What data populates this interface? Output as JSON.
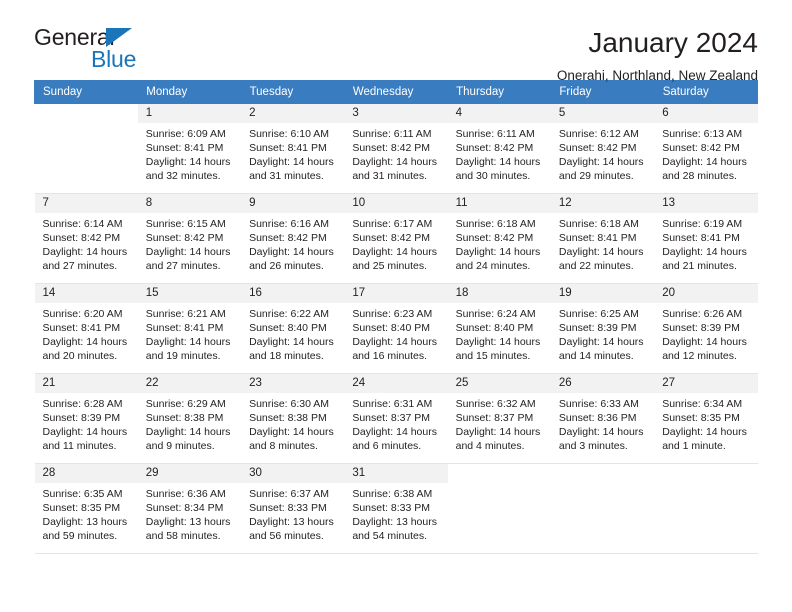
{
  "brand": {
    "name_part1": "General",
    "name_part2": "Blue",
    "accent_color": "#1b75bb",
    "triangle_icon": "logo-triangle-icon"
  },
  "header": {
    "title": "January 2024",
    "subtitle": "Onerahi, Northland, New Zealand"
  },
  "calendar": {
    "header_bg": "#3a7cc0",
    "daynum_bg": "#f2f2f2",
    "weekdays": [
      "Sunday",
      "Monday",
      "Tuesday",
      "Wednesday",
      "Thursday",
      "Friday",
      "Saturday"
    ],
    "weeks": [
      [
        {
          "day": "",
          "sunrise": "",
          "sunset": "",
          "daylight1": "",
          "daylight2": "",
          "empty": true
        },
        {
          "day": "1",
          "sunrise": "Sunrise: 6:09 AM",
          "sunset": "Sunset: 8:41 PM",
          "daylight1": "Daylight: 14 hours",
          "daylight2": "and 32 minutes."
        },
        {
          "day": "2",
          "sunrise": "Sunrise: 6:10 AM",
          "sunset": "Sunset: 8:41 PM",
          "daylight1": "Daylight: 14 hours",
          "daylight2": "and 31 minutes."
        },
        {
          "day": "3",
          "sunrise": "Sunrise: 6:11 AM",
          "sunset": "Sunset: 8:42 PM",
          "daylight1": "Daylight: 14 hours",
          "daylight2": "and 31 minutes."
        },
        {
          "day": "4",
          "sunrise": "Sunrise: 6:11 AM",
          "sunset": "Sunset: 8:42 PM",
          "daylight1": "Daylight: 14 hours",
          "daylight2": "and 30 minutes."
        },
        {
          "day": "5",
          "sunrise": "Sunrise: 6:12 AM",
          "sunset": "Sunset: 8:42 PM",
          "daylight1": "Daylight: 14 hours",
          "daylight2": "and 29 minutes."
        },
        {
          "day": "6",
          "sunrise": "Sunrise: 6:13 AM",
          "sunset": "Sunset: 8:42 PM",
          "daylight1": "Daylight: 14 hours",
          "daylight2": "and 28 minutes."
        }
      ],
      [
        {
          "day": "7",
          "sunrise": "Sunrise: 6:14 AM",
          "sunset": "Sunset: 8:42 PM",
          "daylight1": "Daylight: 14 hours",
          "daylight2": "and 27 minutes."
        },
        {
          "day": "8",
          "sunrise": "Sunrise: 6:15 AM",
          "sunset": "Sunset: 8:42 PM",
          "daylight1": "Daylight: 14 hours",
          "daylight2": "and 27 minutes."
        },
        {
          "day": "9",
          "sunrise": "Sunrise: 6:16 AM",
          "sunset": "Sunset: 8:42 PM",
          "daylight1": "Daylight: 14 hours",
          "daylight2": "and 26 minutes."
        },
        {
          "day": "10",
          "sunrise": "Sunrise: 6:17 AM",
          "sunset": "Sunset: 8:42 PM",
          "daylight1": "Daylight: 14 hours",
          "daylight2": "and 25 minutes."
        },
        {
          "day": "11",
          "sunrise": "Sunrise: 6:18 AM",
          "sunset": "Sunset: 8:42 PM",
          "daylight1": "Daylight: 14 hours",
          "daylight2": "and 24 minutes."
        },
        {
          "day": "12",
          "sunrise": "Sunrise: 6:18 AM",
          "sunset": "Sunset: 8:41 PM",
          "daylight1": "Daylight: 14 hours",
          "daylight2": "and 22 minutes."
        },
        {
          "day": "13",
          "sunrise": "Sunrise: 6:19 AM",
          "sunset": "Sunset: 8:41 PM",
          "daylight1": "Daylight: 14 hours",
          "daylight2": "and 21 minutes."
        }
      ],
      [
        {
          "day": "14",
          "sunrise": "Sunrise: 6:20 AM",
          "sunset": "Sunset: 8:41 PM",
          "daylight1": "Daylight: 14 hours",
          "daylight2": "and 20 minutes."
        },
        {
          "day": "15",
          "sunrise": "Sunrise: 6:21 AM",
          "sunset": "Sunset: 8:41 PM",
          "daylight1": "Daylight: 14 hours",
          "daylight2": "and 19 minutes."
        },
        {
          "day": "16",
          "sunrise": "Sunrise: 6:22 AM",
          "sunset": "Sunset: 8:40 PM",
          "daylight1": "Daylight: 14 hours",
          "daylight2": "and 18 minutes."
        },
        {
          "day": "17",
          "sunrise": "Sunrise: 6:23 AM",
          "sunset": "Sunset: 8:40 PM",
          "daylight1": "Daylight: 14 hours",
          "daylight2": "and 16 minutes."
        },
        {
          "day": "18",
          "sunrise": "Sunrise: 6:24 AM",
          "sunset": "Sunset: 8:40 PM",
          "daylight1": "Daylight: 14 hours",
          "daylight2": "and 15 minutes."
        },
        {
          "day": "19",
          "sunrise": "Sunrise: 6:25 AM",
          "sunset": "Sunset: 8:39 PM",
          "daylight1": "Daylight: 14 hours",
          "daylight2": "and 14 minutes."
        },
        {
          "day": "20",
          "sunrise": "Sunrise: 6:26 AM",
          "sunset": "Sunset: 8:39 PM",
          "daylight1": "Daylight: 14 hours",
          "daylight2": "and 12 minutes."
        }
      ],
      [
        {
          "day": "21",
          "sunrise": "Sunrise: 6:28 AM",
          "sunset": "Sunset: 8:39 PM",
          "daylight1": "Daylight: 14 hours",
          "daylight2": "and 11 minutes."
        },
        {
          "day": "22",
          "sunrise": "Sunrise: 6:29 AM",
          "sunset": "Sunset: 8:38 PM",
          "daylight1": "Daylight: 14 hours",
          "daylight2": "and 9 minutes."
        },
        {
          "day": "23",
          "sunrise": "Sunrise: 6:30 AM",
          "sunset": "Sunset: 8:38 PM",
          "daylight1": "Daylight: 14 hours",
          "daylight2": "and 8 minutes."
        },
        {
          "day": "24",
          "sunrise": "Sunrise: 6:31 AM",
          "sunset": "Sunset: 8:37 PM",
          "daylight1": "Daylight: 14 hours",
          "daylight2": "and 6 minutes."
        },
        {
          "day": "25",
          "sunrise": "Sunrise: 6:32 AM",
          "sunset": "Sunset: 8:37 PM",
          "daylight1": "Daylight: 14 hours",
          "daylight2": "and 4 minutes."
        },
        {
          "day": "26",
          "sunrise": "Sunrise: 6:33 AM",
          "sunset": "Sunset: 8:36 PM",
          "daylight1": "Daylight: 14 hours",
          "daylight2": "and 3 minutes."
        },
        {
          "day": "27",
          "sunrise": "Sunrise: 6:34 AM",
          "sunset": "Sunset: 8:35 PM",
          "daylight1": "Daylight: 14 hours",
          "daylight2": "and 1 minute."
        }
      ],
      [
        {
          "day": "28",
          "sunrise": "Sunrise: 6:35 AM",
          "sunset": "Sunset: 8:35 PM",
          "daylight1": "Daylight: 13 hours",
          "daylight2": "and 59 minutes."
        },
        {
          "day": "29",
          "sunrise": "Sunrise: 6:36 AM",
          "sunset": "Sunset: 8:34 PM",
          "daylight1": "Daylight: 13 hours",
          "daylight2": "and 58 minutes."
        },
        {
          "day": "30",
          "sunrise": "Sunrise: 6:37 AM",
          "sunset": "Sunset: 8:33 PM",
          "daylight1": "Daylight: 13 hours",
          "daylight2": "and 56 minutes."
        },
        {
          "day": "31",
          "sunrise": "Sunrise: 6:38 AM",
          "sunset": "Sunset: 8:33 PM",
          "daylight1": "Daylight: 13 hours",
          "daylight2": "and 54 minutes."
        },
        {
          "day": "",
          "sunrise": "",
          "sunset": "",
          "daylight1": "",
          "daylight2": "",
          "empty": true
        },
        {
          "day": "",
          "sunrise": "",
          "sunset": "",
          "daylight1": "",
          "daylight2": "",
          "empty": true
        },
        {
          "day": "",
          "sunrise": "",
          "sunset": "",
          "daylight1": "",
          "daylight2": "",
          "empty": true
        }
      ]
    ]
  }
}
